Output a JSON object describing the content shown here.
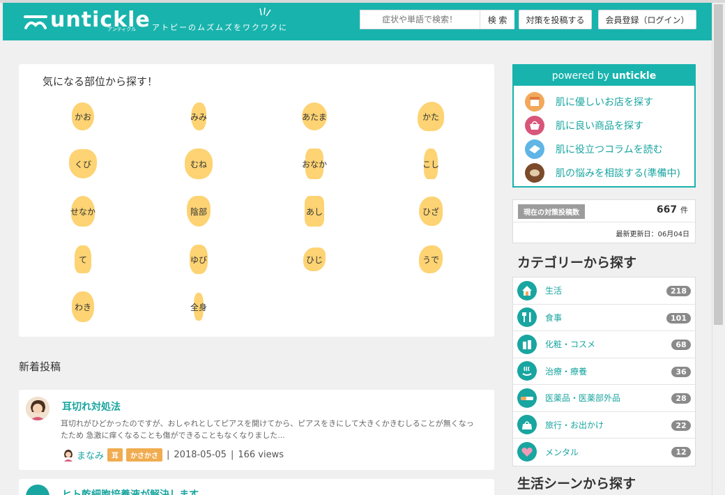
{
  "header": {
    "logo_text": "untickle",
    "logo_kana": "アンティクル",
    "tagline": "アトピーのムズムズをワクワクに",
    "search_placeholder": "症状や単語で検索！",
    "search_button": "検 索",
    "post_button": "対策を投稿する",
    "login_button": "会員登録（ログイン）",
    "brand_color": "#19b3ad"
  },
  "body_parts": {
    "title": "気になる部位から探す！",
    "items": [
      {
        "label": "かお"
      },
      {
        "label": "みみ"
      },
      {
        "label": "あたま"
      },
      {
        "label": "かた"
      },
      {
        "label": "くび"
      },
      {
        "label": "むね"
      },
      {
        "label": "おなか"
      },
      {
        "label": "こし"
      },
      {
        "label": "せなか"
      },
      {
        "label": "陰部"
      },
      {
        "label": "あし"
      },
      {
        "label": "ひざ"
      },
      {
        "label": "て"
      },
      {
        "label": "ゆび"
      },
      {
        "label": "ひじ"
      },
      {
        "label": "うで"
      },
      {
        "label": "わき"
      },
      {
        "label": "全身"
      }
    ]
  },
  "new_posts": {
    "title": "新着投稿",
    "posts": [
      {
        "title": "耳切れ対処法",
        "body": "耳切れがひどかったのですが、おしゃれとしてピアスを開けてから、ピアスをきにして大きくかきむしることが無くなったため 急激に痒くなることも傷ができることもなくなりました...",
        "author": "まなみ",
        "tags": [
          "耳",
          "かさかさ"
        ],
        "date": "2018-05-05",
        "views": "166 views"
      },
      {
        "title": "ヒト乾細胞培養液が解決します"
      }
    ]
  },
  "powered": {
    "prefix": "powered by",
    "brand": "untickle",
    "items": [
      {
        "label": "肌に優しいお店を探す",
        "icon": "shop-icon",
        "color": "#f2a85a"
      },
      {
        "label": "肌に良い商品を探す",
        "icon": "basket-icon",
        "color": "#d8567a"
      },
      {
        "label": "肌に役立つコラムを読む",
        "icon": "magazine-icon",
        "color": "#5fb5e5"
      },
      {
        "label": "肌の悩みを相談する(準備中)",
        "icon": "chat-icon",
        "color": "#7a4a2a"
      }
    ]
  },
  "stats": {
    "badge": "現在の対策投稿数",
    "count": "667",
    "unit": "件",
    "updated": "最新更新日：06月04日"
  },
  "categories": {
    "title": "カテゴリーから探す",
    "items": [
      {
        "label": "生活",
        "count": "218",
        "icon": "house-icon"
      },
      {
        "label": "食事",
        "count": "101",
        "icon": "cutlery-icon"
      },
      {
        "label": "化粧・コスメ",
        "count": "68",
        "icon": "cosmetics-icon"
      },
      {
        "label": "治療・療養",
        "count": "36",
        "icon": "onsen-icon"
      },
      {
        "label": "医薬品・医薬部外品",
        "count": "28",
        "icon": "medicine-icon"
      },
      {
        "label": "旅行・お出かけ",
        "count": "22",
        "icon": "bag-icon"
      },
      {
        "label": "メンタル",
        "count": "12",
        "icon": "heart-icon"
      }
    ]
  },
  "scenes": {
    "title": "生活シーンから探す"
  }
}
